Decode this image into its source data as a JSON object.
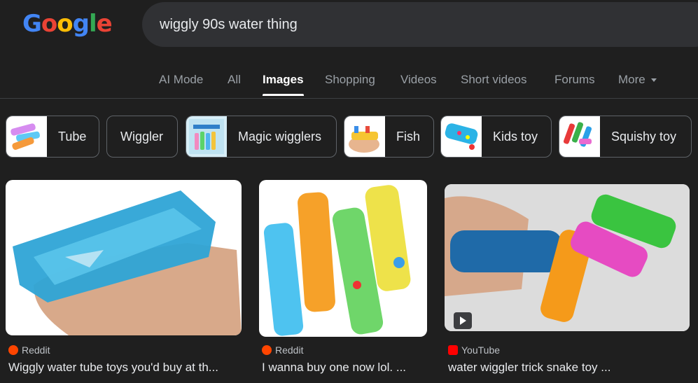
{
  "logo": {
    "text": "Google",
    "letters": [
      "G",
      "o",
      "o",
      "g",
      "l",
      "e"
    ],
    "colors": [
      "#4285f4",
      "#ea4335",
      "#fbbc05",
      "#4285f4",
      "#34a853",
      "#ea4335"
    ]
  },
  "search": {
    "query": "wiggly 90s water thing"
  },
  "tabs": [
    {
      "label": "AI Mode",
      "active": false
    },
    {
      "label": "All",
      "active": false
    },
    {
      "label": "Images",
      "active": true
    },
    {
      "label": "Shopping",
      "active": false
    },
    {
      "label": "Videos",
      "active": false
    },
    {
      "label": "Short videos",
      "active": false
    },
    {
      "label": "Forums",
      "active": false
    },
    {
      "label": "More",
      "active": false
    }
  ],
  "chips": [
    {
      "label": "Tube",
      "has_thumb": true
    },
    {
      "label": "Wiggler",
      "has_thumb": false
    },
    {
      "label": "Magic wigglers",
      "has_thumb": true
    },
    {
      "label": "Fish",
      "has_thumb": true
    },
    {
      "label": "Kids toy",
      "has_thumb": true
    },
    {
      "label": "Squishy toy",
      "has_thumb": true
    }
  ],
  "results": [
    {
      "source": "Reddit",
      "source_icon": "reddit-icon",
      "title": "Wiggly water tube toys you'd buy at th..."
    },
    {
      "source": "Reddit",
      "source_icon": "reddit-icon",
      "title": "I wanna buy one now lol. ..."
    },
    {
      "source": "YouTube",
      "source_icon": "youtube-icon",
      "title": "water wiggler trick snake toy ...",
      "has_play": true
    }
  ],
  "colors": {
    "background": "#1f1f1f",
    "searchbar": "#303134",
    "reddit": "#ff4500",
    "youtube": "#ff0000"
  }
}
